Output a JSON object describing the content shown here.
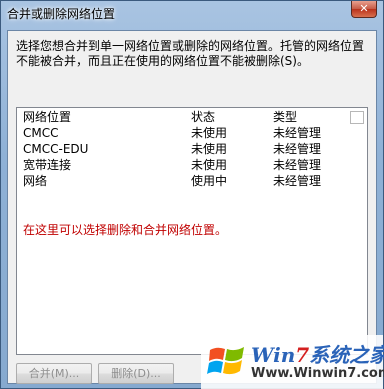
{
  "window": {
    "title": "合并或删除网络位置",
    "close_glyph": "✕"
  },
  "instructions": "选择您想合并到单一网络位置或删除的网络位置。托管的网络位置不能被合并，而且正在使用的网络位置不能被删除(S)。",
  "list": {
    "columns": {
      "name": "网络位置",
      "status": "状态",
      "type": "类型"
    },
    "rows": [
      {
        "name": "CMCC",
        "status": "未使用",
        "type": "未经管理"
      },
      {
        "name": "CMCC-EDU",
        "status": "未使用",
        "type": "未经管理"
      },
      {
        "name": "宽带连接",
        "status": "未使用",
        "type": "未经管理"
      },
      {
        "name": "网络",
        "status": "使用中",
        "type": "未经管理"
      }
    ],
    "hint": "在这里可以选择删除和合并网络位置。"
  },
  "buttons": {
    "merge": "合并(M)...",
    "delete": "删除(D)..."
  },
  "watermark": {
    "title_pre": "Win",
    "title_num": "7",
    "title_post": "系统之家",
    "subtitle": "Www.Winwin7.com"
  },
  "colors": {
    "hint_text": "#c00000",
    "title_glass": "#a9c4e2",
    "watermark_blue": "#2a63b8"
  }
}
